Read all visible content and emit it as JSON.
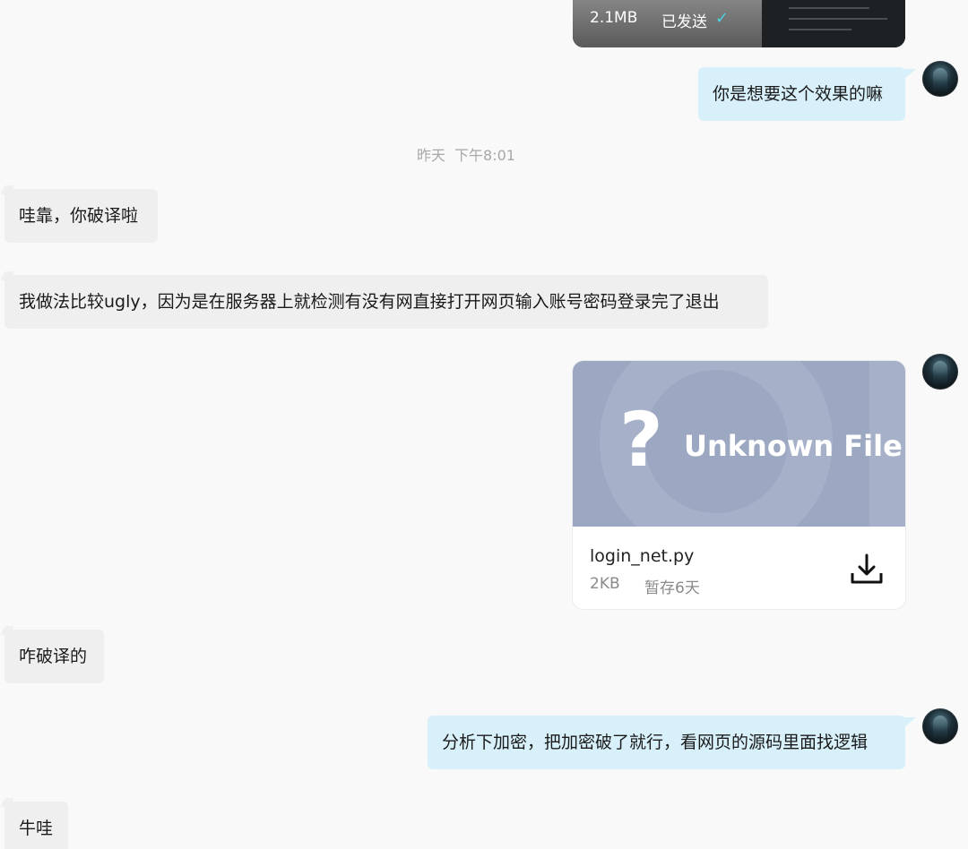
{
  "messages": {
    "top_file": {
      "size": "2.1MB",
      "status": "已发送",
      "check": "✓"
    },
    "m1": "你是想要这个效果的嘛",
    "timestamp": {
      "day": "昨天",
      "time": "下午8:01"
    },
    "m2": "哇靠，你破译啦",
    "m3": "我做法比较ugly，因为是在服务器上就检测有没有网直接打开网页输入账号密码登录完了退出",
    "file": {
      "preview_mark": "?",
      "preview_text": "Unknown File",
      "name": "login_net.py",
      "size": "2KB",
      "expire": "暂存6天"
    },
    "m4": "咋破译的",
    "m5": "分析下加密，把加密破了就行，看网页的源码里面找逻辑",
    "m6": "牛哇"
  },
  "colors": {
    "background": "#f9f9f9",
    "incoming_bubble": "#efefef",
    "outgoing_bubble": "#d7f0fa",
    "sent_check": "#4cd3e3",
    "unknown_file_preview": "#9ca8c2"
  },
  "icons": {
    "download": "download-icon",
    "sent": "check-icon"
  }
}
